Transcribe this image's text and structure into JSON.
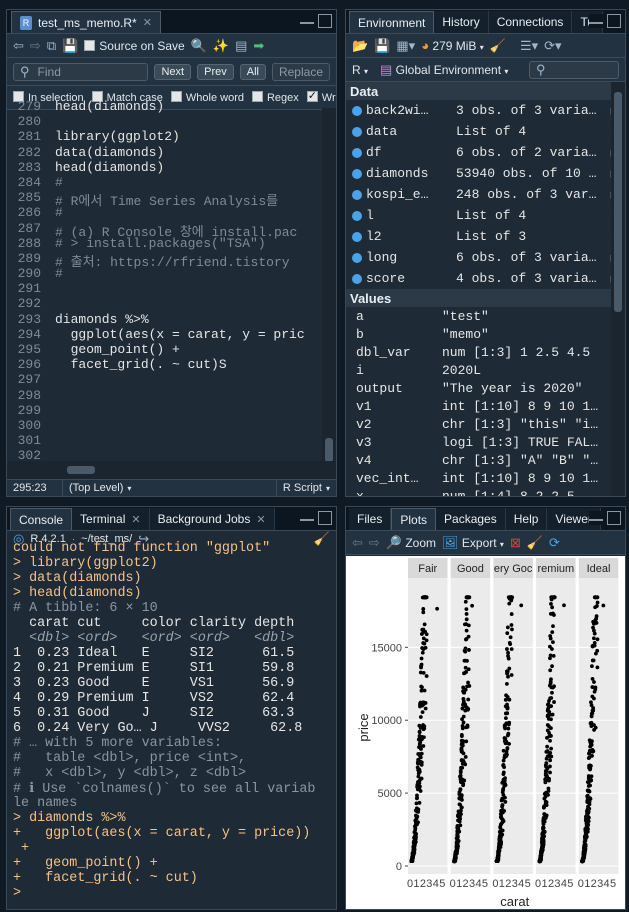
{
  "editor": {
    "tab_label": "test_ms_memo.R*",
    "source_on_save": "Source on Save",
    "find_placeholder": "Find",
    "next": "Next",
    "prev": "Prev",
    "all": "All",
    "replace": "Replace",
    "in_selection": "In selection",
    "match_case": "Match case",
    "whole_word": "Whole word",
    "regex": "Regex",
    "wrap": "Wrap",
    "lines": [
      {
        "n": "279",
        "t": "head(diamonds)",
        "c": "txt"
      },
      {
        "n": "280",
        "t": "",
        "c": "txt"
      },
      {
        "n": "281",
        "t": "library(ggplot2)",
        "c": "txt"
      },
      {
        "n": "282",
        "t": "data(diamonds)",
        "c": "txt"
      },
      {
        "n": "283",
        "t": "head(diamonds)",
        "c": "txt"
      },
      {
        "n": "284",
        "t": "#",
        "c": "cmt"
      },
      {
        "n": "285",
        "t": "# R에서 Time Series Analysis를",
        "c": "cmt"
      },
      {
        "n": "286",
        "t": "#",
        "c": "cmt"
      },
      {
        "n": "287",
        "t": "# (a) R Console 창에 install.pac",
        "c": "cmt"
      },
      {
        "n": "288",
        "t": "# > install.packages(\"TSA\")",
        "c": "cmt"
      },
      {
        "n": "289",
        "t": "# 출처: https://rfriend.tistory",
        "c": "cmt"
      },
      {
        "n": "290",
        "t": "#",
        "c": "cmt"
      },
      {
        "n": "291",
        "t": "",
        "c": "txt"
      },
      {
        "n": "292",
        "t": "",
        "c": "txt"
      },
      {
        "n": "293",
        "t": "diamonds %>%",
        "c": "txt"
      },
      {
        "n": "294",
        "t": "  ggplot(aes(x = carat, y = pric",
        "c": "txt"
      },
      {
        "n": "295",
        "t": "  geom_point() +",
        "c": "txt"
      },
      {
        "n": "296",
        "t": "  facet_grid(. ~ cut)S",
        "c": "txt"
      },
      {
        "n": "297",
        "t": "",
        "c": "txt"
      },
      {
        "n": "298",
        "t": "",
        "c": "txt"
      },
      {
        "n": "299",
        "t": "",
        "c": "txt"
      },
      {
        "n": "300",
        "t": "",
        "c": "txt"
      },
      {
        "n": "301",
        "t": "",
        "c": "txt"
      },
      {
        "n": "302",
        "t": "",
        "c": "txt"
      }
    ],
    "status_pos": "295:23",
    "status_level": "(Top Level)",
    "status_lang": "R Script"
  },
  "environment": {
    "tabs": [
      "Environment",
      "History",
      "Connections",
      "Tu"
    ],
    "memory": "279 MiB",
    "lang": "R",
    "scope": "Global Environment",
    "data_header": "Data",
    "data": [
      {
        "name": "back2wi…",
        "value": "3 obs. of 3 varia…",
        "icon": "grid"
      },
      {
        "name": "data",
        "value": "List of  4",
        "icon": "search"
      },
      {
        "name": "df",
        "value": "6 obs. of 2 varia…",
        "icon": "grid"
      },
      {
        "name": "diamonds",
        "value": "53940 obs. of 10 …",
        "icon": "grid"
      },
      {
        "name": "kospi_e…",
        "value": "248 obs. of 3 var…",
        "icon": "grid"
      },
      {
        "name": "l",
        "value": "List of  4",
        "icon": "search"
      },
      {
        "name": "l2",
        "value": "List of  3",
        "icon": "search"
      },
      {
        "name": "long",
        "value": "6 obs. of 3 varia…",
        "icon": "grid"
      },
      {
        "name": "score",
        "value": "4 obs. of 3 varia…",
        "icon": "grid"
      }
    ],
    "values_header": "Values",
    "values": [
      {
        "name": "a",
        "value": "\"test\""
      },
      {
        "name": "b",
        "value": "\"memo\""
      },
      {
        "name": "dbl_var",
        "value": "num [1:3] 1 2.5 4.5"
      },
      {
        "name": "i",
        "value": "2020L"
      },
      {
        "name": "output",
        "value": "\"The year is 2020\""
      },
      {
        "name": "v1",
        "value": "int [1:10] 8 9 10 1…"
      },
      {
        "name": "v2",
        "value": "chr [1:3] \"this\" \"i…"
      },
      {
        "name": "v3",
        "value": "logi [1:3] TRUE FAL…"
      },
      {
        "name": "v4",
        "value": "chr [1:3] \"A\" \"B\" \"…"
      },
      {
        "name": "vec_int…",
        "value": "int [1:10] 8 9 10 1…"
      },
      {
        "name": "x",
        "value": "num [1:4] 8 2 2 5"
      }
    ]
  },
  "console": {
    "tabs": [
      "Console",
      "Terminal",
      "Background Jobs"
    ],
    "r_version": "R 4.2.1",
    "path": "~/test_ms/",
    "lines": [
      {
        "t": "could not find function \"ggplot\"",
        "c": "pr"
      },
      {
        "t": "> library(ggplot2)",
        "c": "pr"
      },
      {
        "t": "> data(diamonds)",
        "c": "pr"
      },
      {
        "t": "> head(diamonds)",
        "c": "pr"
      },
      {
        "t": "# A tibble: 6 × 10",
        "c": "gr"
      },
      {
        "t": "  carat cut     color clarity depth",
        "c": ""
      },
      {
        "t": "  <dbl> <ord>   <ord> <ord>   <dbl>",
        "c": "ital"
      },
      {
        "t": "1  0.23 Ideal   E     SI2      61.5",
        "c": ""
      },
      {
        "t": "2  0.21 Premium E     SI1      59.8",
        "c": ""
      },
      {
        "t": "3  0.23 Good    E     VS1      56.9",
        "c": ""
      },
      {
        "t": "4  0.29 Premium I     VS2      62.4",
        "c": ""
      },
      {
        "t": "5  0.31 Good    J     SI2      63.3",
        "c": ""
      },
      {
        "t": "6  0.24 Very Go… J     VVS2     62.8",
        "c": ""
      },
      {
        "t": "# … with 5 more variables:",
        "c": "gr"
      },
      {
        "t": "#   table <dbl>, price <int>,",
        "c": "gr"
      },
      {
        "t": "#   x <dbl>, y <dbl>, z <dbl>",
        "c": "gr"
      },
      {
        "t": "# ℹ Use `colnames()` to see all variab",
        "c": "gr"
      },
      {
        "t": "le names",
        "c": "gr"
      },
      {
        "t": "> diamonds %>%",
        "c": "pr"
      },
      {
        "t": "+   ggplot(aes(x = carat, y = price))",
        "c": "pr"
      },
      {
        "t": " +",
        "c": "pr"
      },
      {
        "t": "+   geom_point() +",
        "c": "pr"
      },
      {
        "t": "+   facet_grid(. ~ cut)",
        "c": "pr"
      },
      {
        "t": "> ",
        "c": "pr"
      }
    ]
  },
  "plots": {
    "tabs": [
      "Files",
      "Plots",
      "Packages",
      "Help",
      "Viewer"
    ],
    "zoom": "Zoom",
    "export": "Export"
  },
  "chart_data": {
    "type": "scatter",
    "facets": [
      "Fair",
      "Good",
      "Very Good",
      "Premium",
      "Ideal"
    ],
    "facet_labels_shown": [
      "Fair",
      "Good",
      "ery Goc",
      "remium",
      "Ideal"
    ],
    "xlabel": "carat",
    "ylabel": "price",
    "x_ticks": [
      "0",
      "1",
      "2",
      "3",
      "4",
      "5"
    ],
    "y_ticks": [
      0,
      5000,
      10000,
      15000
    ],
    "y_tick_labels": [
      "0",
      "5000",
      "10000",
      "15000"
    ],
    "xlim": [
      0,
      5.5
    ],
    "ylim": [
      0,
      19000
    ],
    "series": [
      {
        "facet": "Fair",
        "x_range": [
          0.22,
          5.01
        ],
        "y_range": [
          337,
          18574
        ]
      },
      {
        "facet": "Good",
        "x_range": [
          0.23,
          3.01
        ],
        "y_range": [
          327,
          18788
        ]
      },
      {
        "facet": "Very Good",
        "x_range": [
          0.2,
          4.0
        ],
        "y_range": [
          336,
          18818
        ]
      },
      {
        "facet": "Premium",
        "x_range": [
          0.2,
          4.01
        ],
        "y_range": [
          326,
          18823
        ]
      },
      {
        "facet": "Ideal",
        "x_range": [
          0.2,
          3.5
        ],
        "y_range": [
          326,
          18806
        ]
      }
    ],
    "point_color": "#000000",
    "panel_bg": "#ebebeb",
    "strip_bg": "#d9d9d9"
  }
}
